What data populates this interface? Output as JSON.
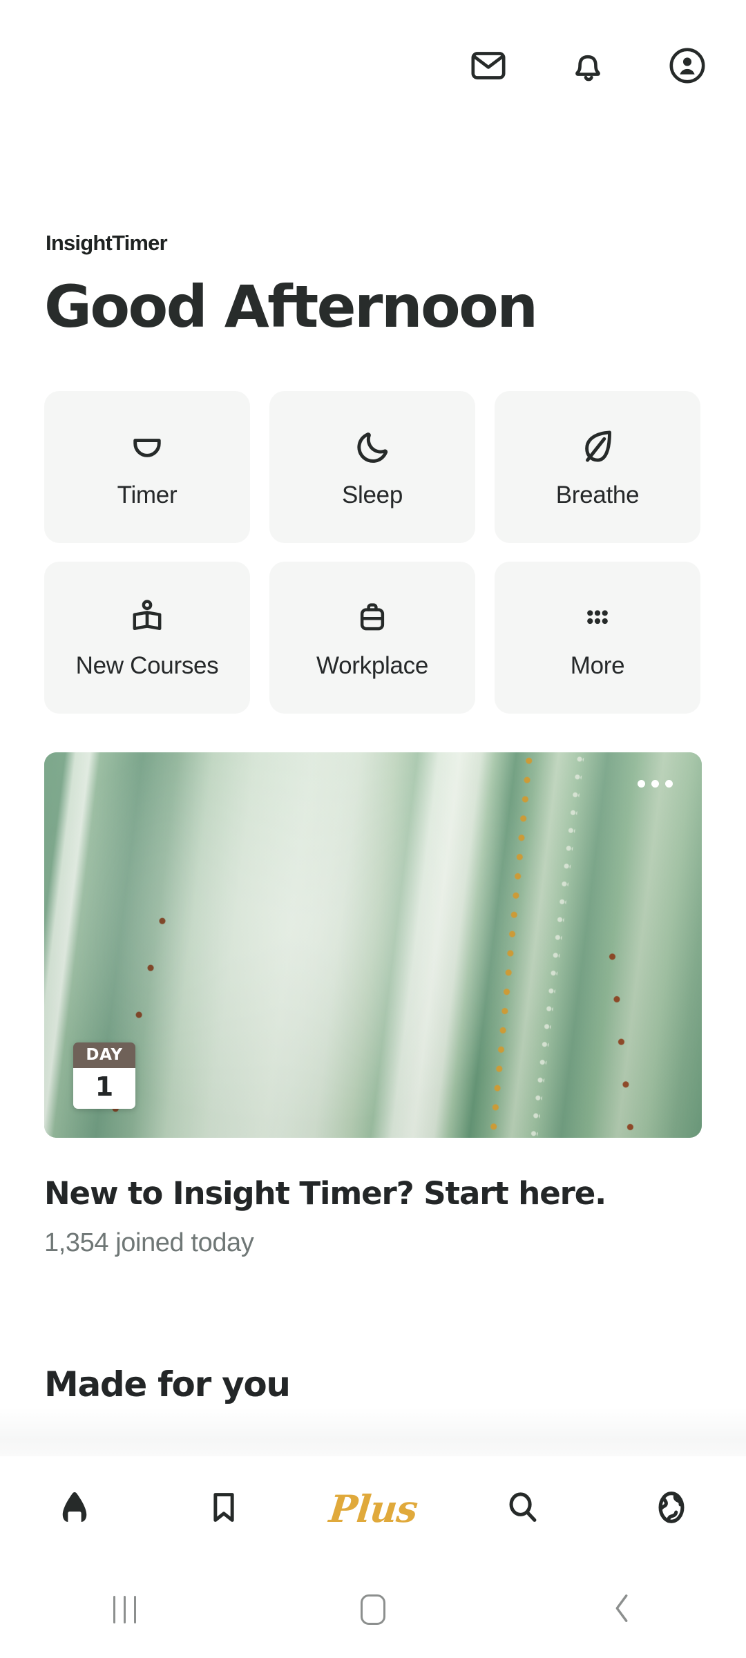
{
  "app": {
    "brand": "InsightTimer",
    "greeting": "Good Afternoon"
  },
  "topbar": {
    "icons": [
      {
        "name": "mail-icon",
        "label": "Messages"
      },
      {
        "name": "bell-icon",
        "label": "Notifications"
      },
      {
        "name": "account-circle-icon",
        "label": "Profile"
      }
    ]
  },
  "tiles": [
    {
      "label": "Timer",
      "icon": "singing-bowl-icon"
    },
    {
      "label": "Sleep",
      "icon": "moon-icon"
    },
    {
      "label": "Breathe",
      "icon": "leaf-icon"
    },
    {
      "label": "New Courses",
      "icon": "open-book-icon"
    },
    {
      "label": "Workplace",
      "icon": "briefcase-icon"
    },
    {
      "label": "More",
      "icon": "grid-dots-icon"
    }
  ],
  "hero": {
    "day_label": "DAY",
    "day_number": "1",
    "title": "New to Insight Timer? Start here.",
    "subtitle": "1,354 joined today",
    "more_icon": "overflow-dots-icon",
    "image_alt": "agave-leaves-photo"
  },
  "sections": {
    "made_for_you": "Made for you"
  },
  "bottom_nav": [
    {
      "name": "home",
      "icon": "home-icon",
      "label": ""
    },
    {
      "name": "library",
      "icon": "bookmark-icon",
      "label": ""
    },
    {
      "name": "plus",
      "icon": "plus-wordmark",
      "label": "Plus"
    },
    {
      "name": "search",
      "icon": "search-icon",
      "label": ""
    },
    {
      "name": "explore",
      "icon": "globe-icon",
      "label": ""
    }
  ],
  "system_nav": [
    {
      "name": "recents",
      "icon": "recents-icon"
    },
    {
      "name": "home",
      "icon": "home-square-icon"
    },
    {
      "name": "back",
      "icon": "back-chevron-icon"
    }
  ],
  "colors": {
    "accent_gold": "#e0a93b",
    "text_primary": "#232627",
    "text_muted": "#6f7776",
    "tile_bg": "#f5f6f5",
    "day_badge_header": "#6f6158"
  }
}
